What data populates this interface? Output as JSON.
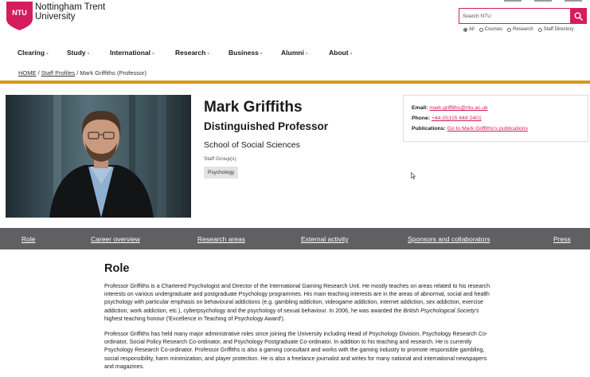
{
  "header": {
    "brand_badge": "NTU",
    "brand_line1": "Nottingham Trent",
    "brand_line2": "University",
    "brand_color": "#d41d5c",
    "search": {
      "placeholder": "Search NTU",
      "icon": "search-icon",
      "scopes": [
        {
          "label": "All",
          "selected": true
        },
        {
          "label": "Courses",
          "selected": false
        },
        {
          "label": "Research",
          "selected": false
        },
        {
          "label": "Staff Directory",
          "selected": false
        }
      ]
    }
  },
  "nav": {
    "items": [
      "Clearing",
      "Study",
      "International",
      "Research",
      "Business",
      "Alumni",
      "About"
    ],
    "caret": "-"
  },
  "breadcrumb": {
    "home": "HOME",
    "sep1": " / ",
    "staff": "Staff Profiles",
    "sep2": " / ",
    "current": "Mark Griffiths (Professor)"
  },
  "profile": {
    "name": "Mark Griffiths",
    "job_title": "Distinguished Professor",
    "school": "School of Social Sciences",
    "group_label": "Staff Group(s)",
    "group_tag": "Psychology",
    "accent_color": "#d09a1a"
  },
  "contact": {
    "email_label": "Email:",
    "email": "mark.griffiths@ntu.ac.uk",
    "phone_label": "Phone:",
    "phone": "+44 (0)115 848 2401",
    "pubs_label": "Publications:",
    "pubs_link": "Go to Mark Griffiths's publications"
  },
  "tabs": [
    "Role",
    "Career overview",
    "Research areas",
    "External activity",
    "Sponsors and collaborators",
    "Press"
  ],
  "role": {
    "title": "Role",
    "p1_before": "Professor Griffiths is a Chartered Psychologist and Director of the International Gaming Research Unit. He mostly teaches on areas related to his research interests on various undergraduate and postgraduate Psychology programmes. His main teaching interests are in the areas of abnormal, social and health psychology with particular emphasis on behavioural addictions (e.g. gambling addiction, videogame addiction, internet addiction, sex addiction, exercise addiction, work addiction, etc.), cyberpsychology and the psychology of sexual behaviour. In 2006, he was awarded the ",
    "p1_italic": "British Psychological Society's",
    "p1_after": " highest teaching honour ('Excellence in Teaching of Psychology Award').",
    "p2": "Professor Griffiths has held many major administrative roles since joining the University including Head of Psychology Division, Psychology Research Co-ordinator, Social Policy Research Co-ordinator, and Psychology Postgraduate Co-ordinator. In addition to his teaching and research. He is currently Psychology Research Co-ordinator. Professor Griffiths is also a gaming consultant and works with the gaming industry to promote responsible gambling, social responsibility, harm minimization, and player protection. He is also a freelance journalist and writes for many national and international newspapers and magazines."
  }
}
